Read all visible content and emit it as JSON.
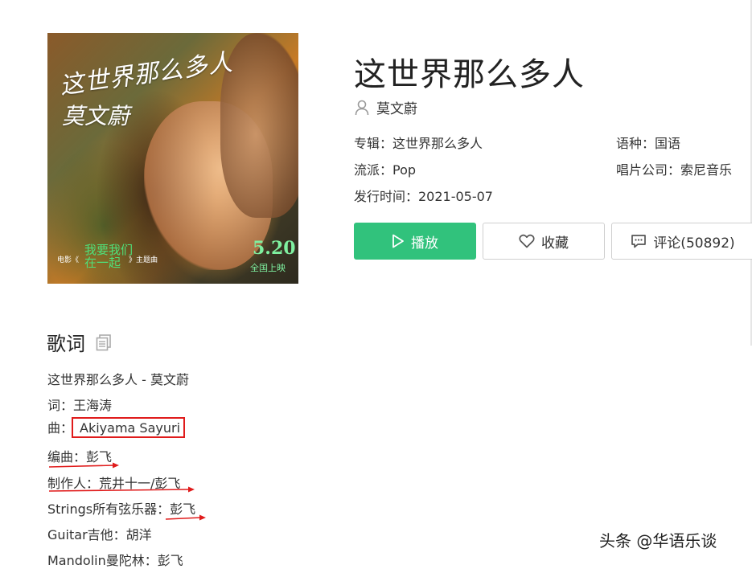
{
  "album_cover": {
    "title_script": "这世界那么多人",
    "artist_script": "莫文蔚",
    "film_prefix": "电影《",
    "film_title": "我要我们在一起",
    "film_suffix": "》主题曲",
    "release_date": "5.20",
    "release_note": "全国上映"
  },
  "song": {
    "title": "这世界那么多人",
    "artist": "莫文蔚"
  },
  "meta": {
    "album": "专辑：这世界那么多人",
    "language": "语种：国语",
    "genre": "流派：Pop",
    "label": "唱片公司：索尼音乐",
    "release_time": "发行时间：2021-05-07"
  },
  "buttons": {
    "play": "播放",
    "favorite": "收藏",
    "comment": "评论(50892)"
  },
  "lyrics": {
    "heading": "歌词",
    "lines": [
      "这世界那么多人 - 莫文蔚",
      "词：王海涛",
      "曲：",
      "编曲：彭飞",
      "制作人：荒井十一/彭飞",
      "Strings所有弦乐器：彭飞",
      "Guitar吉他：胡洋",
      "Mandolin曼陀林：彭飞"
    ],
    "composer_highlight": "Akiyama Sayuri"
  },
  "watermark": "头条 @华语乐谈",
  "colors": {
    "play_green": "#31c27c",
    "annotation_red": "#e01b1b"
  },
  "icons": [
    "user-icon",
    "play-icon",
    "heart-icon",
    "comment-icon",
    "copy-icon"
  ]
}
